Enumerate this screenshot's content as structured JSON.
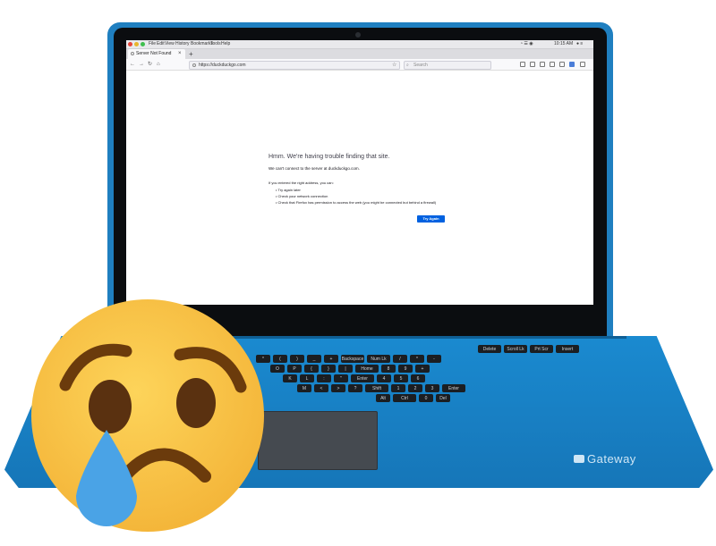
{
  "browser": {
    "menu_items": [
      "File",
      "Edit",
      "View",
      "History",
      "Bookmarks",
      "Tools",
      "Help"
    ],
    "status_time": "10:15 AM",
    "tab_title": "Server Not Found",
    "url": "https://duckduckgo.com",
    "search_placeholder": "Search"
  },
  "error_page": {
    "title": "Hmm. We're having trouble finding that site.",
    "message": "We can't connect to the server at duckduckgo.com.",
    "intro": "If you entered the right address, you can:",
    "suggestions": [
      "Try again later",
      "Check your network connection",
      "Check that Firefox has permission to access the web (you might be connected but behind a firewall)"
    ],
    "button": "Try Again"
  },
  "laptop": {
    "brand": "Gateway",
    "body_color": "#1a86c9"
  },
  "keyboard": {
    "rows": [
      [
        "Delete",
        "Scroll Lk",
        "Prt Scr",
        "Insert"
      ],
      [
        "*",
        "(",
        ")",
        "_",
        "+",
        "Backspace",
        "Num Lk",
        "/",
        "*",
        "-"
      ],
      [
        "O",
        "P",
        "{",
        "}",
        "|",
        "Home",
        "8",
        "9",
        "+"
      ],
      [
        "K",
        "L",
        ":",
        "\"",
        "Enter",
        "4",
        "5",
        "6"
      ],
      [
        "M",
        "<",
        ">",
        "?",
        "Shift",
        "1",
        "2",
        "3",
        "Enter"
      ],
      [
        "Alt",
        "Ctrl",
        "0",
        "Del"
      ]
    ]
  },
  "overlay": {
    "emoji": "sad-but-relieved-face"
  }
}
